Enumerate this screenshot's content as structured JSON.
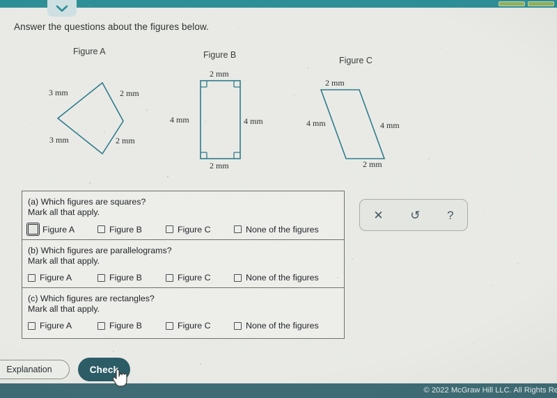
{
  "topbar": {
    "chevron_icon": "chevron-down-icon",
    "chips": [
      "",
      ""
    ]
  },
  "prompt": "Answer the questions about the figures below.",
  "figures": [
    {
      "title": "Figure A",
      "shape": "quadrilateral",
      "labels": [
        {
          "text": "3 mm",
          "pos": "upper-left"
        },
        {
          "text": "2 mm",
          "pos": "upper-right"
        },
        {
          "text": "3 mm",
          "pos": "lower-left"
        },
        {
          "text": "2 mm",
          "pos": "lower-right"
        }
      ]
    },
    {
      "title": "Figure B",
      "shape": "rectangle",
      "labels": [
        {
          "text": "2 mm",
          "pos": "top"
        },
        {
          "text": "4 mm",
          "pos": "left"
        },
        {
          "text": "4 mm",
          "pos": "right"
        },
        {
          "text": "2 mm",
          "pos": "bottom"
        }
      ]
    },
    {
      "title": "Figure C",
      "shape": "parallelogram",
      "labels": [
        {
          "text": "2 mm",
          "pos": "top"
        },
        {
          "text": "4 mm",
          "pos": "left"
        },
        {
          "text": "4 mm",
          "pos": "right"
        },
        {
          "text": "2 mm",
          "pos": "bottom"
        }
      ]
    }
  ],
  "questions": [
    {
      "line1": "(a) Which figures are squares?",
      "line2": "Mark all that apply.",
      "options": [
        "Figure A",
        "Figure B",
        "Figure C",
        "None of the figures"
      ],
      "focused_index": 0
    },
    {
      "line1": "(b) Which figures are parallelograms?",
      "line2": "Mark all that apply.",
      "options": [
        "Figure A",
        "Figure B",
        "Figure C",
        "None of the figures"
      ],
      "focused_index": -1
    },
    {
      "line1": "(c) Which figures are rectangles?",
      "line2": "Mark all that apply.",
      "options": [
        "Figure A",
        "Figure B",
        "Figure C",
        "None of the figures"
      ],
      "focused_index": -1
    }
  ],
  "tools": [
    {
      "name": "clear-button",
      "glyph": "✕"
    },
    {
      "name": "undo-button",
      "glyph": "↺"
    },
    {
      "name": "help-button",
      "glyph": "?"
    }
  ],
  "actions": {
    "explanation_label": "Explanation",
    "check_label": "Check"
  },
  "footer": {
    "copyright": "© 2022 McGraw Hill LLC. All Rights Re"
  },
  "colors": {
    "accent_teal": "#2e8f97",
    "figure_stroke": "#2e7b8c",
    "check_button": "#2c5c66",
    "footer_bar": "#3e6c75",
    "page_bg": "#e9eae6"
  }
}
